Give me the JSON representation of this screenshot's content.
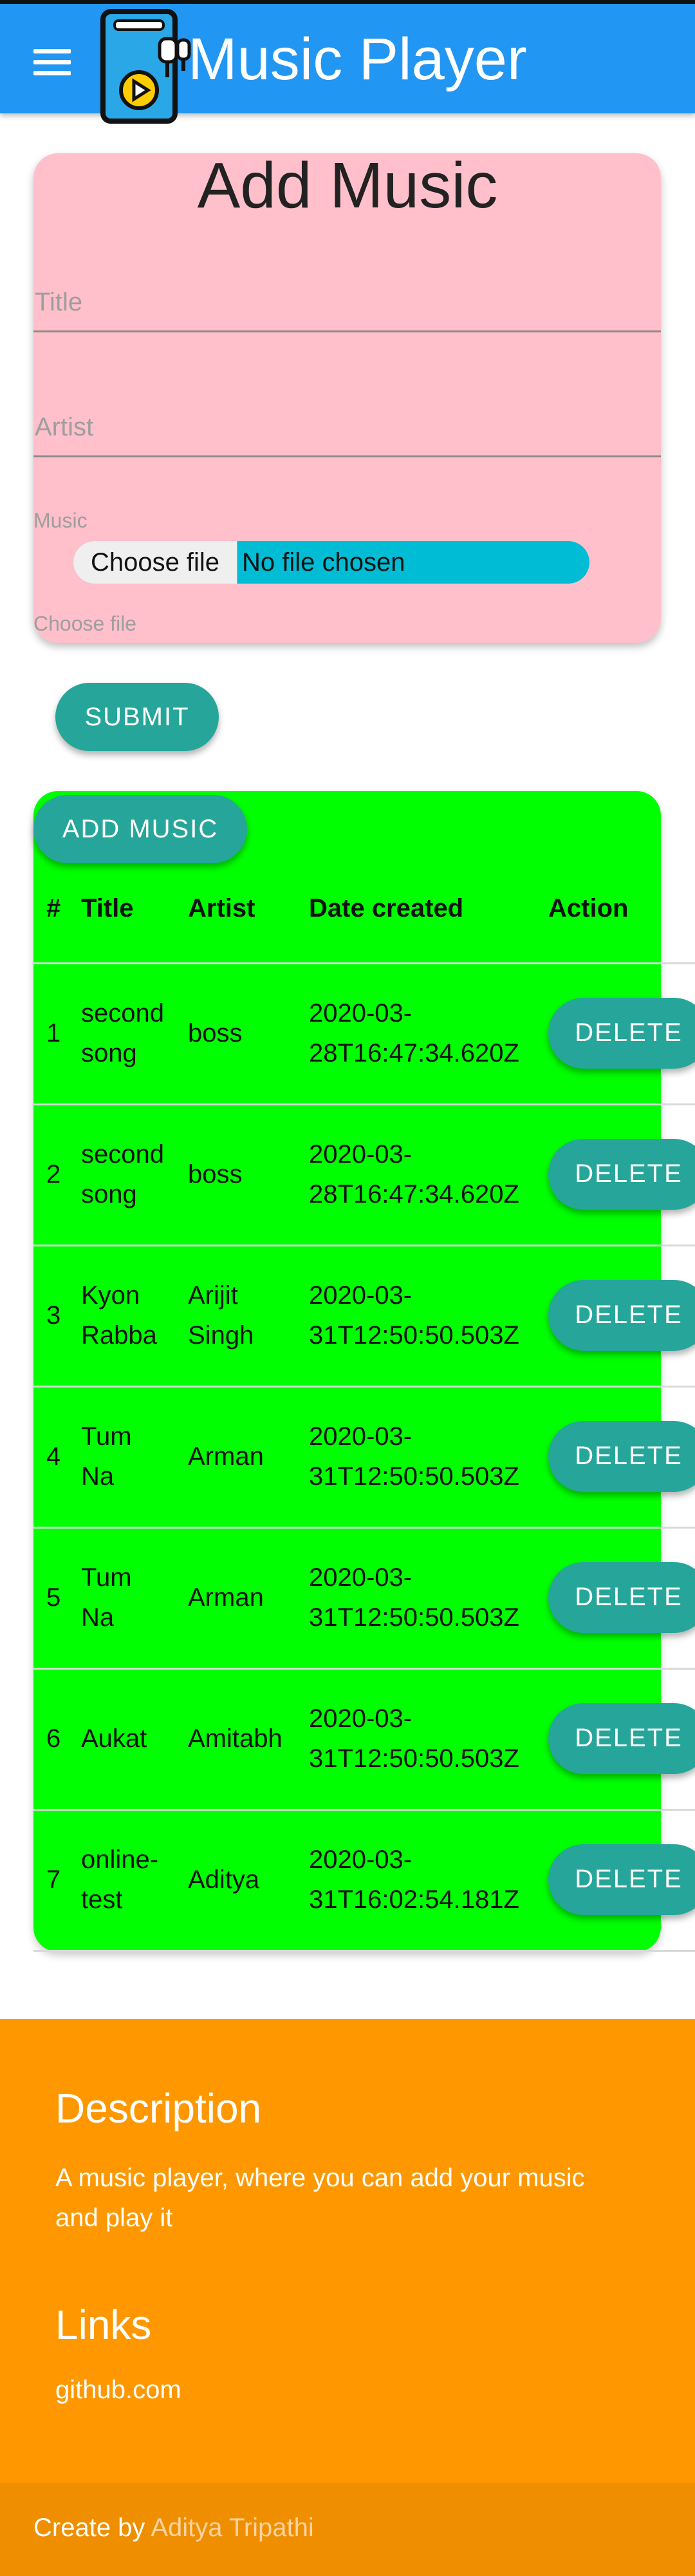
{
  "header": {
    "title": "Music Player",
    "menu_icon": "hamburger-menu-icon",
    "logo_icon": "music-player-phone-icon"
  },
  "add_form": {
    "heading": "Add Music",
    "title_placeholder": "Title",
    "artist_placeholder": "Artist",
    "music_label": "Music",
    "file_button": "Choose file",
    "file_status": "No file chosen",
    "file_helper": "Choose file",
    "submit_label": "SUBMIT"
  },
  "table": {
    "add_button": "ADD MUSIC",
    "headers": [
      "#",
      "Title",
      "Artist",
      "Date created",
      "Action"
    ],
    "rows": [
      {
        "num": "1",
        "title_l1": "second",
        "title_l2": "song",
        "artist_l1": "boss",
        "artist_l2": "",
        "date_l1": "2020-03-",
        "date_l2": "28T16:47:34.620Z",
        "action": "DELETE"
      },
      {
        "num": "2",
        "title_l1": "second",
        "title_l2": "song",
        "artist_l1": "boss",
        "artist_l2": "",
        "date_l1": "2020-03-",
        "date_l2": "28T16:47:34.620Z",
        "action": "DELETE"
      },
      {
        "num": "3",
        "title_l1": "Kyon",
        "title_l2": "Rabba",
        "artist_l1": "Arijit",
        "artist_l2": "Singh",
        "date_l1": "2020-03-",
        "date_l2": "31T12:50:50.503Z",
        "action": "DELETE"
      },
      {
        "num": "4",
        "title_l1": "Tum",
        "title_l2": "Na",
        "artist_l1": "Arman",
        "artist_l2": "",
        "date_l1": "2020-03-",
        "date_l2": "31T12:50:50.503Z",
        "action": "DELETE"
      },
      {
        "num": "5",
        "title_l1": "Tum",
        "title_l2": "Na",
        "artist_l1": "Arman",
        "artist_l2": "",
        "date_l1": "2020-03-",
        "date_l2": "31T12:50:50.503Z",
        "action": "DELETE"
      },
      {
        "num": "6",
        "title_l1": "Aukat",
        "title_l2": "",
        "artist_l1": "Amitabh",
        "artist_l2": "",
        "date_l1": "2020-03-",
        "date_l2": "31T12:50:50.503Z",
        "action": "DELETE"
      },
      {
        "num": "7",
        "title_l1": "online-",
        "title_l2": "test",
        "artist_l1": "Aditya",
        "artist_l2": "",
        "date_l1": "2020-03-",
        "date_l2": "31T16:02:54.181Z",
        "action": "DELETE"
      }
    ]
  },
  "footer": {
    "description_title": "Description",
    "description_text": "A music player, where you can add your music and play it",
    "links_title": "Links",
    "link_github": "github.com",
    "created_prefix": "Create by",
    "created_author": "Aditya Tripathi"
  },
  "colors": {
    "appbar": "#2196f3",
    "form_card": "#ffc0cb",
    "table_card": "#00ff00",
    "button": "#26a69a",
    "footer": "#ff9800",
    "file_picker": "#00bcd4"
  }
}
